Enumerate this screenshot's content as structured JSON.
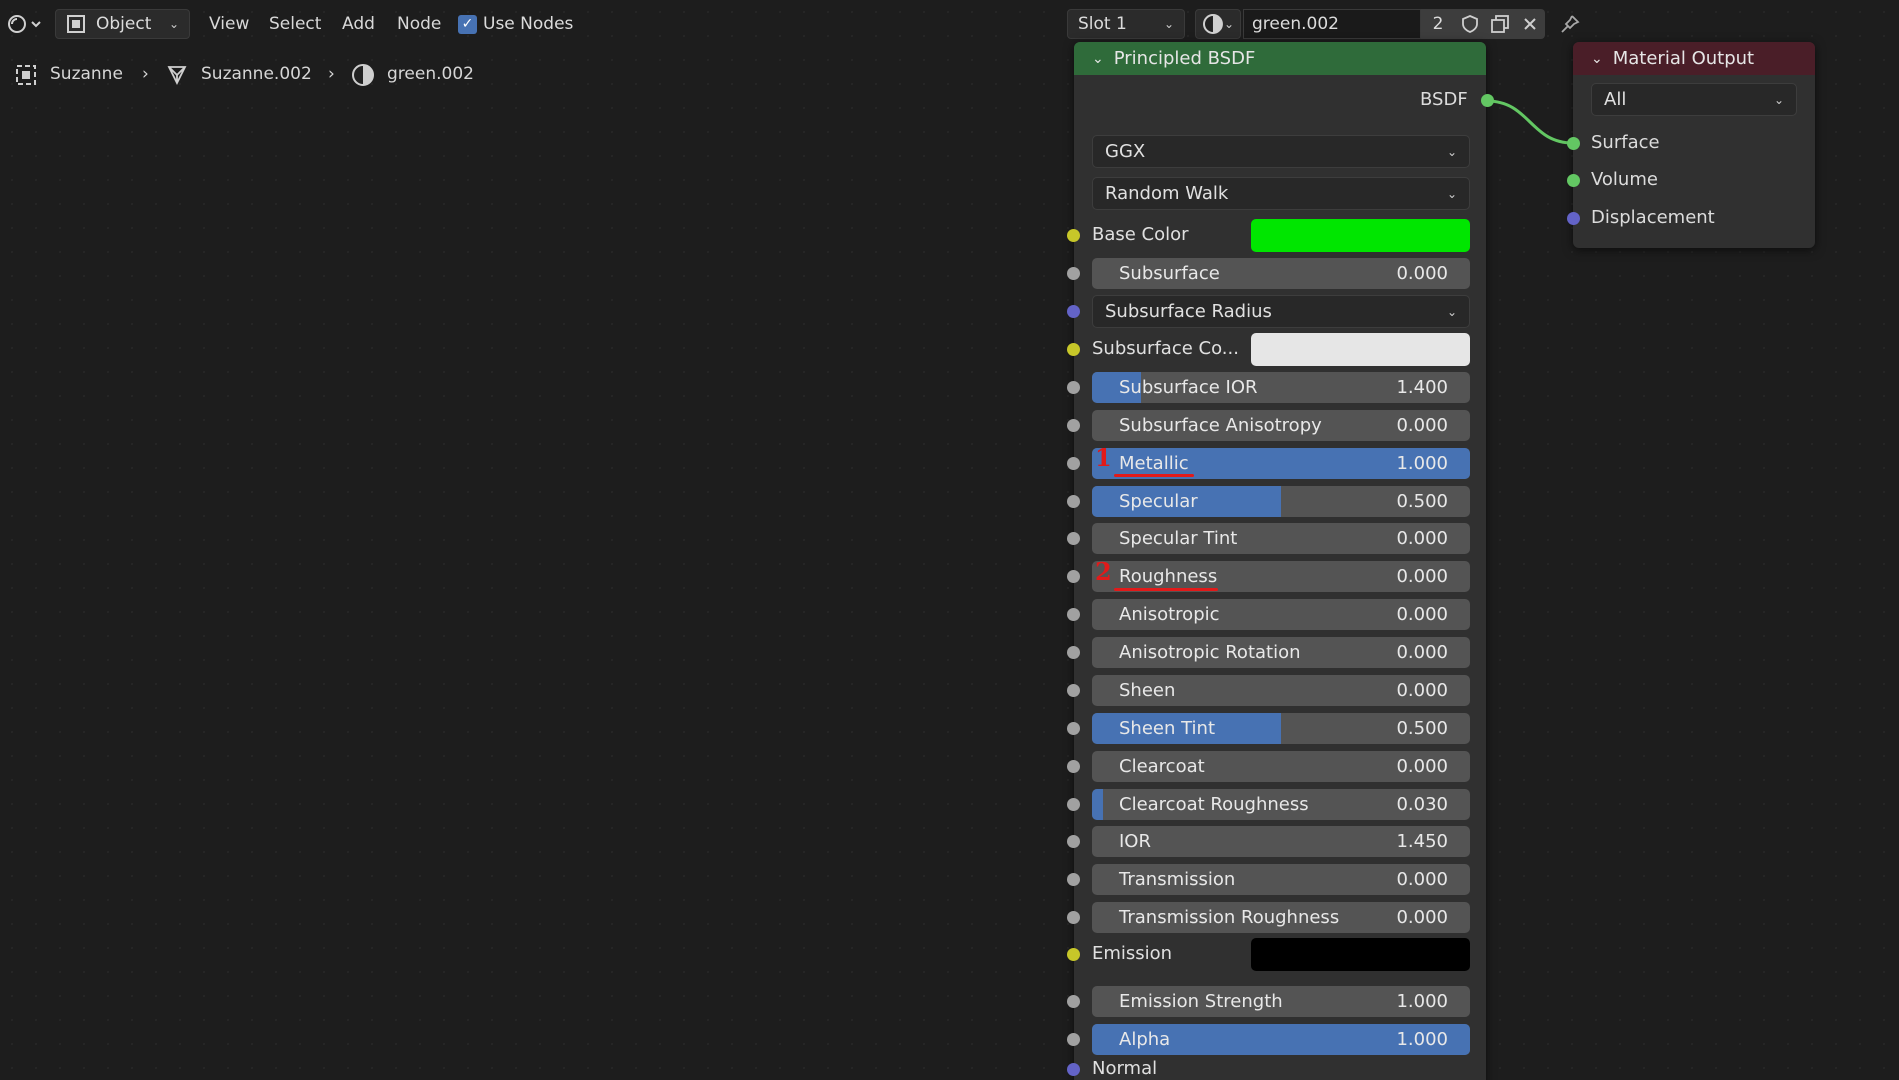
{
  "header": {
    "mode": "Object",
    "menus": [
      "View",
      "Select",
      "Add",
      "Node"
    ],
    "use_nodes_label": "Use Nodes",
    "slot": "Slot 1",
    "material_name": "green.002",
    "users_count": "2"
  },
  "breadcrumb": {
    "object": "Suzanne",
    "mesh": "Suzanne.002",
    "material": "green.002"
  },
  "principled": {
    "title": "Principled BSDF",
    "output_label": "BSDF",
    "distribution": "GGX",
    "subsurface_method": "Random Walk",
    "base_color_label": "Base Color",
    "base_color": "#00e600",
    "subsurface_color_label": "Subsurface Co...",
    "subsurface_color": "#e6e6e6",
    "subsurface_radius_label": "Subsurface Radius",
    "emission_label": "Emission",
    "emission_color": "#000000",
    "normal_label": "Normal",
    "fields": [
      {
        "label": "Subsurface",
        "value": "0.000",
        "fill": 0
      },
      {
        "label": "Subsurface IOR",
        "value": "1.400",
        "fill": 0.13
      },
      {
        "label": "Subsurface Anisotropy",
        "value": "0.000",
        "fill": 0
      },
      {
        "label": "Metallic",
        "value": "1.000",
        "fill": 1
      },
      {
        "label": "Specular",
        "value": "0.500",
        "fill": 0.5
      },
      {
        "label": "Specular Tint",
        "value": "0.000",
        "fill": 0
      },
      {
        "label": "Roughness",
        "value": "0.000",
        "fill": 0
      },
      {
        "label": "Anisotropic",
        "value": "0.000",
        "fill": 0
      },
      {
        "label": "Anisotropic Rotation",
        "value": "0.000",
        "fill": 0
      },
      {
        "label": "Sheen",
        "value": "0.000",
        "fill": 0
      },
      {
        "label": "Sheen Tint",
        "value": "0.500",
        "fill": 0.5
      },
      {
        "label": "Clearcoat",
        "value": "0.000",
        "fill": 0
      },
      {
        "label": "Clearcoat Roughness",
        "value": "0.030",
        "fill": 0.03
      },
      {
        "label": "IOR",
        "value": "1.450",
        "fill": 0
      },
      {
        "label": "Transmission",
        "value": "0.000",
        "fill": 0
      },
      {
        "label": "Transmission Roughness",
        "value": "0.000",
        "fill": 0
      },
      {
        "label": "Emission Strength",
        "value": "1.000",
        "fill": 0
      },
      {
        "label": "Alpha",
        "value": "1.000",
        "fill": 1
      }
    ]
  },
  "material_output": {
    "title": "Material Output",
    "target": "All",
    "inputs": [
      "Surface",
      "Volume",
      "Displacement"
    ]
  },
  "annotations": [
    "1",
    "2"
  ],
  "colors": {
    "accent": "#4772b3",
    "shader_header": "#2f6b3a",
    "output_header": "#4a1e28",
    "annotation": "#e21a1a"
  }
}
